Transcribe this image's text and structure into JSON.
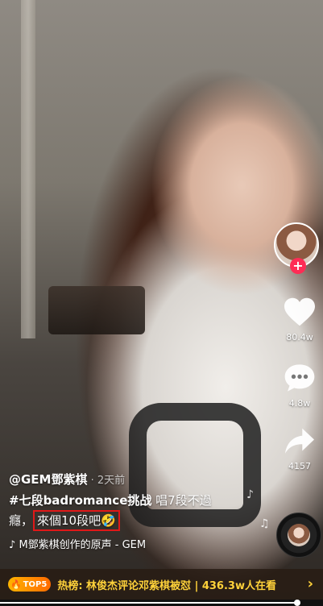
{
  "author": {
    "handle": "@GEM鄧紫棋",
    "separator": " · ",
    "time": "2天前"
  },
  "caption": {
    "hashtag": "#七段badromance挑战",
    "text_line1": " 唱7段不過",
    "text_line2": "癮，",
    "highlighted": "來個10段吧🤣"
  },
  "music": {
    "icon": "♪",
    "label": "M鄧紫棋创作的原声 - GEM"
  },
  "actions": {
    "like_count": "80.4w",
    "comment_count": "4.8w",
    "share_count": "4157",
    "follow_symbol": "+"
  },
  "hot": {
    "badge": "TOP5",
    "text": "热榜: 林俊杰评论邓紫棋被怼 | 436.3w人在看",
    "arrow": "›"
  },
  "playback": {
    "progress_fraction": 0.92
  },
  "colors": {
    "accent_red": "#fe2c55",
    "highlight_border": "#e01818",
    "hot_text": "#ffd23a"
  },
  "icons": [
    "heart-icon",
    "comment-icon",
    "share-icon",
    "music-note-icon",
    "flame-icon",
    "chevron-right-icon"
  ]
}
